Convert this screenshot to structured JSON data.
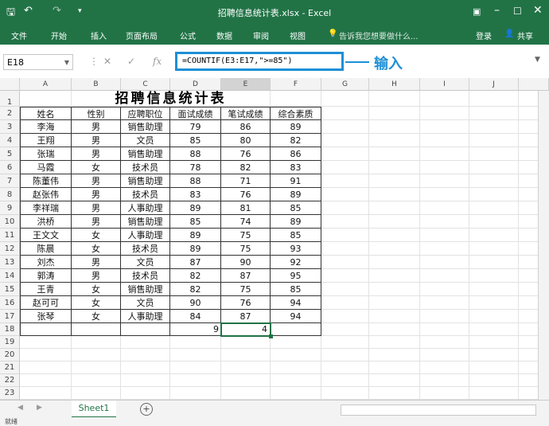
{
  "window": {
    "title": "招聘信息统计表.xlsx - Excel",
    "quick_icons": [
      "save-icon",
      "undo-icon",
      "redo-icon",
      "customize-icon"
    ],
    "controls": [
      "ribbon-display-icon",
      "minimize-icon",
      "maximize-icon",
      "close-icon"
    ]
  },
  "ribbon": {
    "tabs": [
      "文件",
      "开始",
      "插入",
      "页面布局",
      "公式",
      "数据",
      "审阅",
      "视图"
    ],
    "tellme": "告诉我您想要做什么...",
    "login": "登录",
    "share": "共享"
  },
  "formula_bar": {
    "name_box": "E18",
    "formula": "=COUNTIF(E3:E17,\">=85\")",
    "annotation": "输入"
  },
  "sheet": {
    "columns": [
      "A",
      "B",
      "C",
      "D",
      "E",
      "F",
      "G",
      "H",
      "I",
      "J"
    ],
    "title": "招聘信息统计表",
    "headers": [
      "姓名",
      "性别",
      "应聘职位",
      "面试成绩",
      "笔试成绩",
      "综合素质"
    ],
    "rows": [
      [
        "李海",
        "男",
        "销售助理",
        "79",
        "86",
        "89"
      ],
      [
        "王翔",
        "男",
        "文员",
        "85",
        "80",
        "82"
      ],
      [
        "张瑞",
        "男",
        "销售助理",
        "88",
        "76",
        "86"
      ],
      [
        "马霞",
        "女",
        "技术员",
        "78",
        "82",
        "83"
      ],
      [
        "陈董伟",
        "男",
        "销售助理",
        "88",
        "71",
        "91"
      ],
      [
        "赵张伟",
        "男",
        "技术员",
        "83",
        "76",
        "89"
      ],
      [
        "李祥瑞",
        "男",
        "人事助理",
        "89",
        "81",
        "85"
      ],
      [
        "洪桥",
        "男",
        "销售助理",
        "85",
        "74",
        "89"
      ],
      [
        "王文文",
        "女",
        "人事助理",
        "89",
        "75",
        "85"
      ],
      [
        "陈晨",
        "女",
        "技术员",
        "89",
        "75",
        "93"
      ],
      [
        "刘杰",
        "男",
        "文员",
        "87",
        "90",
        "92"
      ],
      [
        "郭涛",
        "男",
        "技术员",
        "82",
        "87",
        "95"
      ],
      [
        "王青",
        "女",
        "销售助理",
        "82",
        "75",
        "85"
      ],
      [
        "赵可可",
        "女",
        "文员",
        "90",
        "76",
        "94"
      ],
      [
        "张琴",
        "女",
        "人事助理",
        "84",
        "87",
        "94"
      ]
    ],
    "row18": {
      "d": "9",
      "e": "4"
    },
    "row_numbers": [
      "1",
      "2",
      "3",
      "4",
      "5",
      "6",
      "7",
      "8",
      "9",
      "10",
      "11",
      "12",
      "13",
      "14",
      "15",
      "16",
      "17",
      "18",
      "19",
      "20",
      "21",
      "22",
      "23"
    ]
  },
  "tabs": {
    "sheet1": "Sheet1",
    "add": "+"
  },
  "status": {
    "left": "就绪"
  }
}
